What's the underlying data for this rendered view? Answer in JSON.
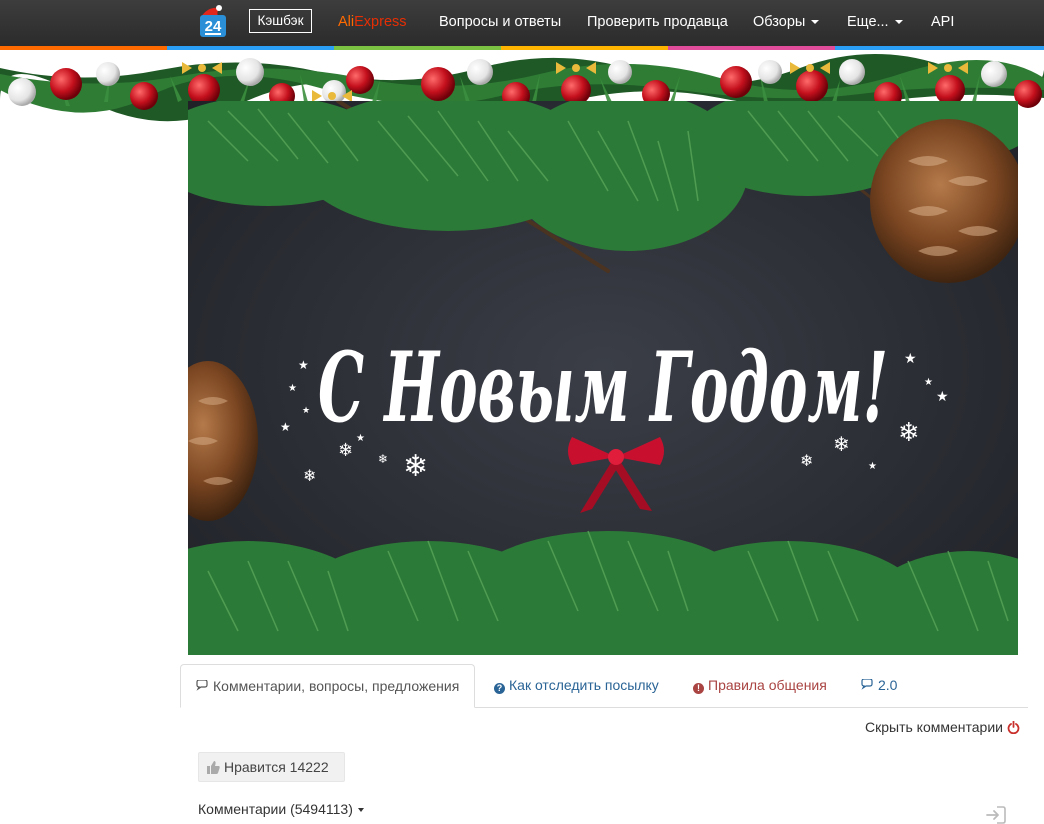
{
  "navbar": {
    "logo_text": "24",
    "cashback_label": "Кэшбэк",
    "aliexpress_part1": "Ali",
    "aliexpress_part2": "Express",
    "items": [
      {
        "label": "Вопросы и ответы"
      },
      {
        "label": "Проверить продавца"
      },
      {
        "label": "Обзоры"
      },
      {
        "label": "Еще..."
      },
      {
        "label": "API"
      }
    ]
  },
  "banner": {
    "greeting": "С Новым Годом!"
  },
  "tabs": [
    {
      "label": "Комментарии, вопросы, предложения",
      "icon": "comments-icon"
    },
    {
      "label": "Как отследить посылку",
      "icon": "question-circle-icon"
    },
    {
      "label": "Правила общения",
      "icon": "exclamation-circle-icon"
    },
    {
      "label": "2.0",
      "icon": "comments-icon"
    }
  ],
  "hide_comments_label": "Скрыть комментарии",
  "like": {
    "label": "Нравится",
    "count": "14222"
  },
  "comments": {
    "label": "Комментарии (5494113)"
  },
  "colors": {
    "navbar_bg": "#2b2b2b",
    "aliexpress_orange": "#ff6a00",
    "aliexpress_red": "#e62e04",
    "tab_blue": "#337ab7",
    "tab_red": "#a94442",
    "banner_bg": "#2a2c33",
    "bow_red": "#c8102e"
  }
}
